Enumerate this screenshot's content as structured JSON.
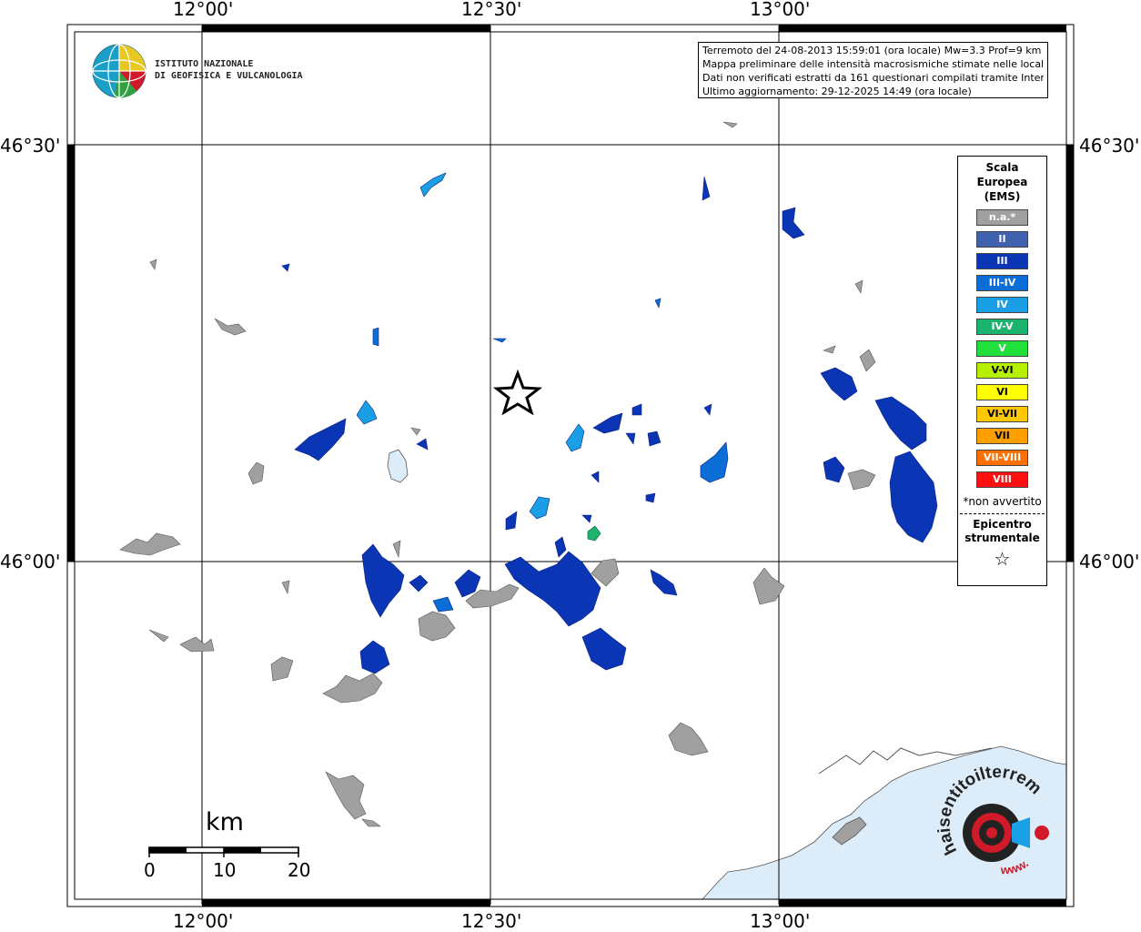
{
  "map": {
    "lon_labels": [
      "12°00'",
      "12°30'",
      "13°00'"
    ],
    "lat_labels": [
      "46°30'",
      "46°00'"
    ]
  },
  "info": {
    "line1": "Terremoto del 24-08-2013 15:59:01 (ora locale) Mw=3.3 Prof=9 km",
    "line2": "Mappa preliminare delle intensità macrosismiche stimate nelle località",
    "line3": "Dati non verificati estratti da 161 questionari compilati tramite Internet.",
    "line4": "Ultimo aggiornamento: 29-12-2025 14:49 (ora locale)"
  },
  "logo": {
    "line1": "ISTITUTO NAZIONALE",
    "line2": "DI GEOFISICA E VULCANOLOGIA"
  },
  "legend": {
    "title_line1": "Scala",
    "title_line2": "Europea",
    "title_line3": "(EMS)",
    "items": [
      {
        "label": "n.a.*",
        "color": "#a0a0a0"
      },
      {
        "label": "II",
        "color": "#4060b0"
      },
      {
        "label": "III",
        "color": "#0a36b5"
      },
      {
        "label": "III-IV",
        "color": "#0a6ed6"
      },
      {
        "label": "IV",
        "color": "#1a9fe6"
      },
      {
        "label": "IV-V",
        "color": "#1cb36e"
      },
      {
        "label": "V",
        "color": "#22e03c"
      },
      {
        "label": "V-VI",
        "color": "#b6f000"
      },
      {
        "label": "VI",
        "color": "#ffff00"
      },
      {
        "label": "VI-VII",
        "color": "#ffc800"
      },
      {
        "label": "VII",
        "color": "#ffa000"
      },
      {
        "label": "VII-VIII",
        "color": "#ff7000"
      },
      {
        "label": "VIII",
        "color": "#ff1010"
      }
    ],
    "note": "*non avvertito",
    "epicenter_line1": "Epicentro",
    "epicenter_line2": "strumentale"
  },
  "scalebar": {
    "unit": "km",
    "ticks": [
      "0",
      "10",
      "20"
    ]
  },
  "brand": {
    "text1": "haisentitoilterremoto.it",
    "text2": "www."
  }
}
